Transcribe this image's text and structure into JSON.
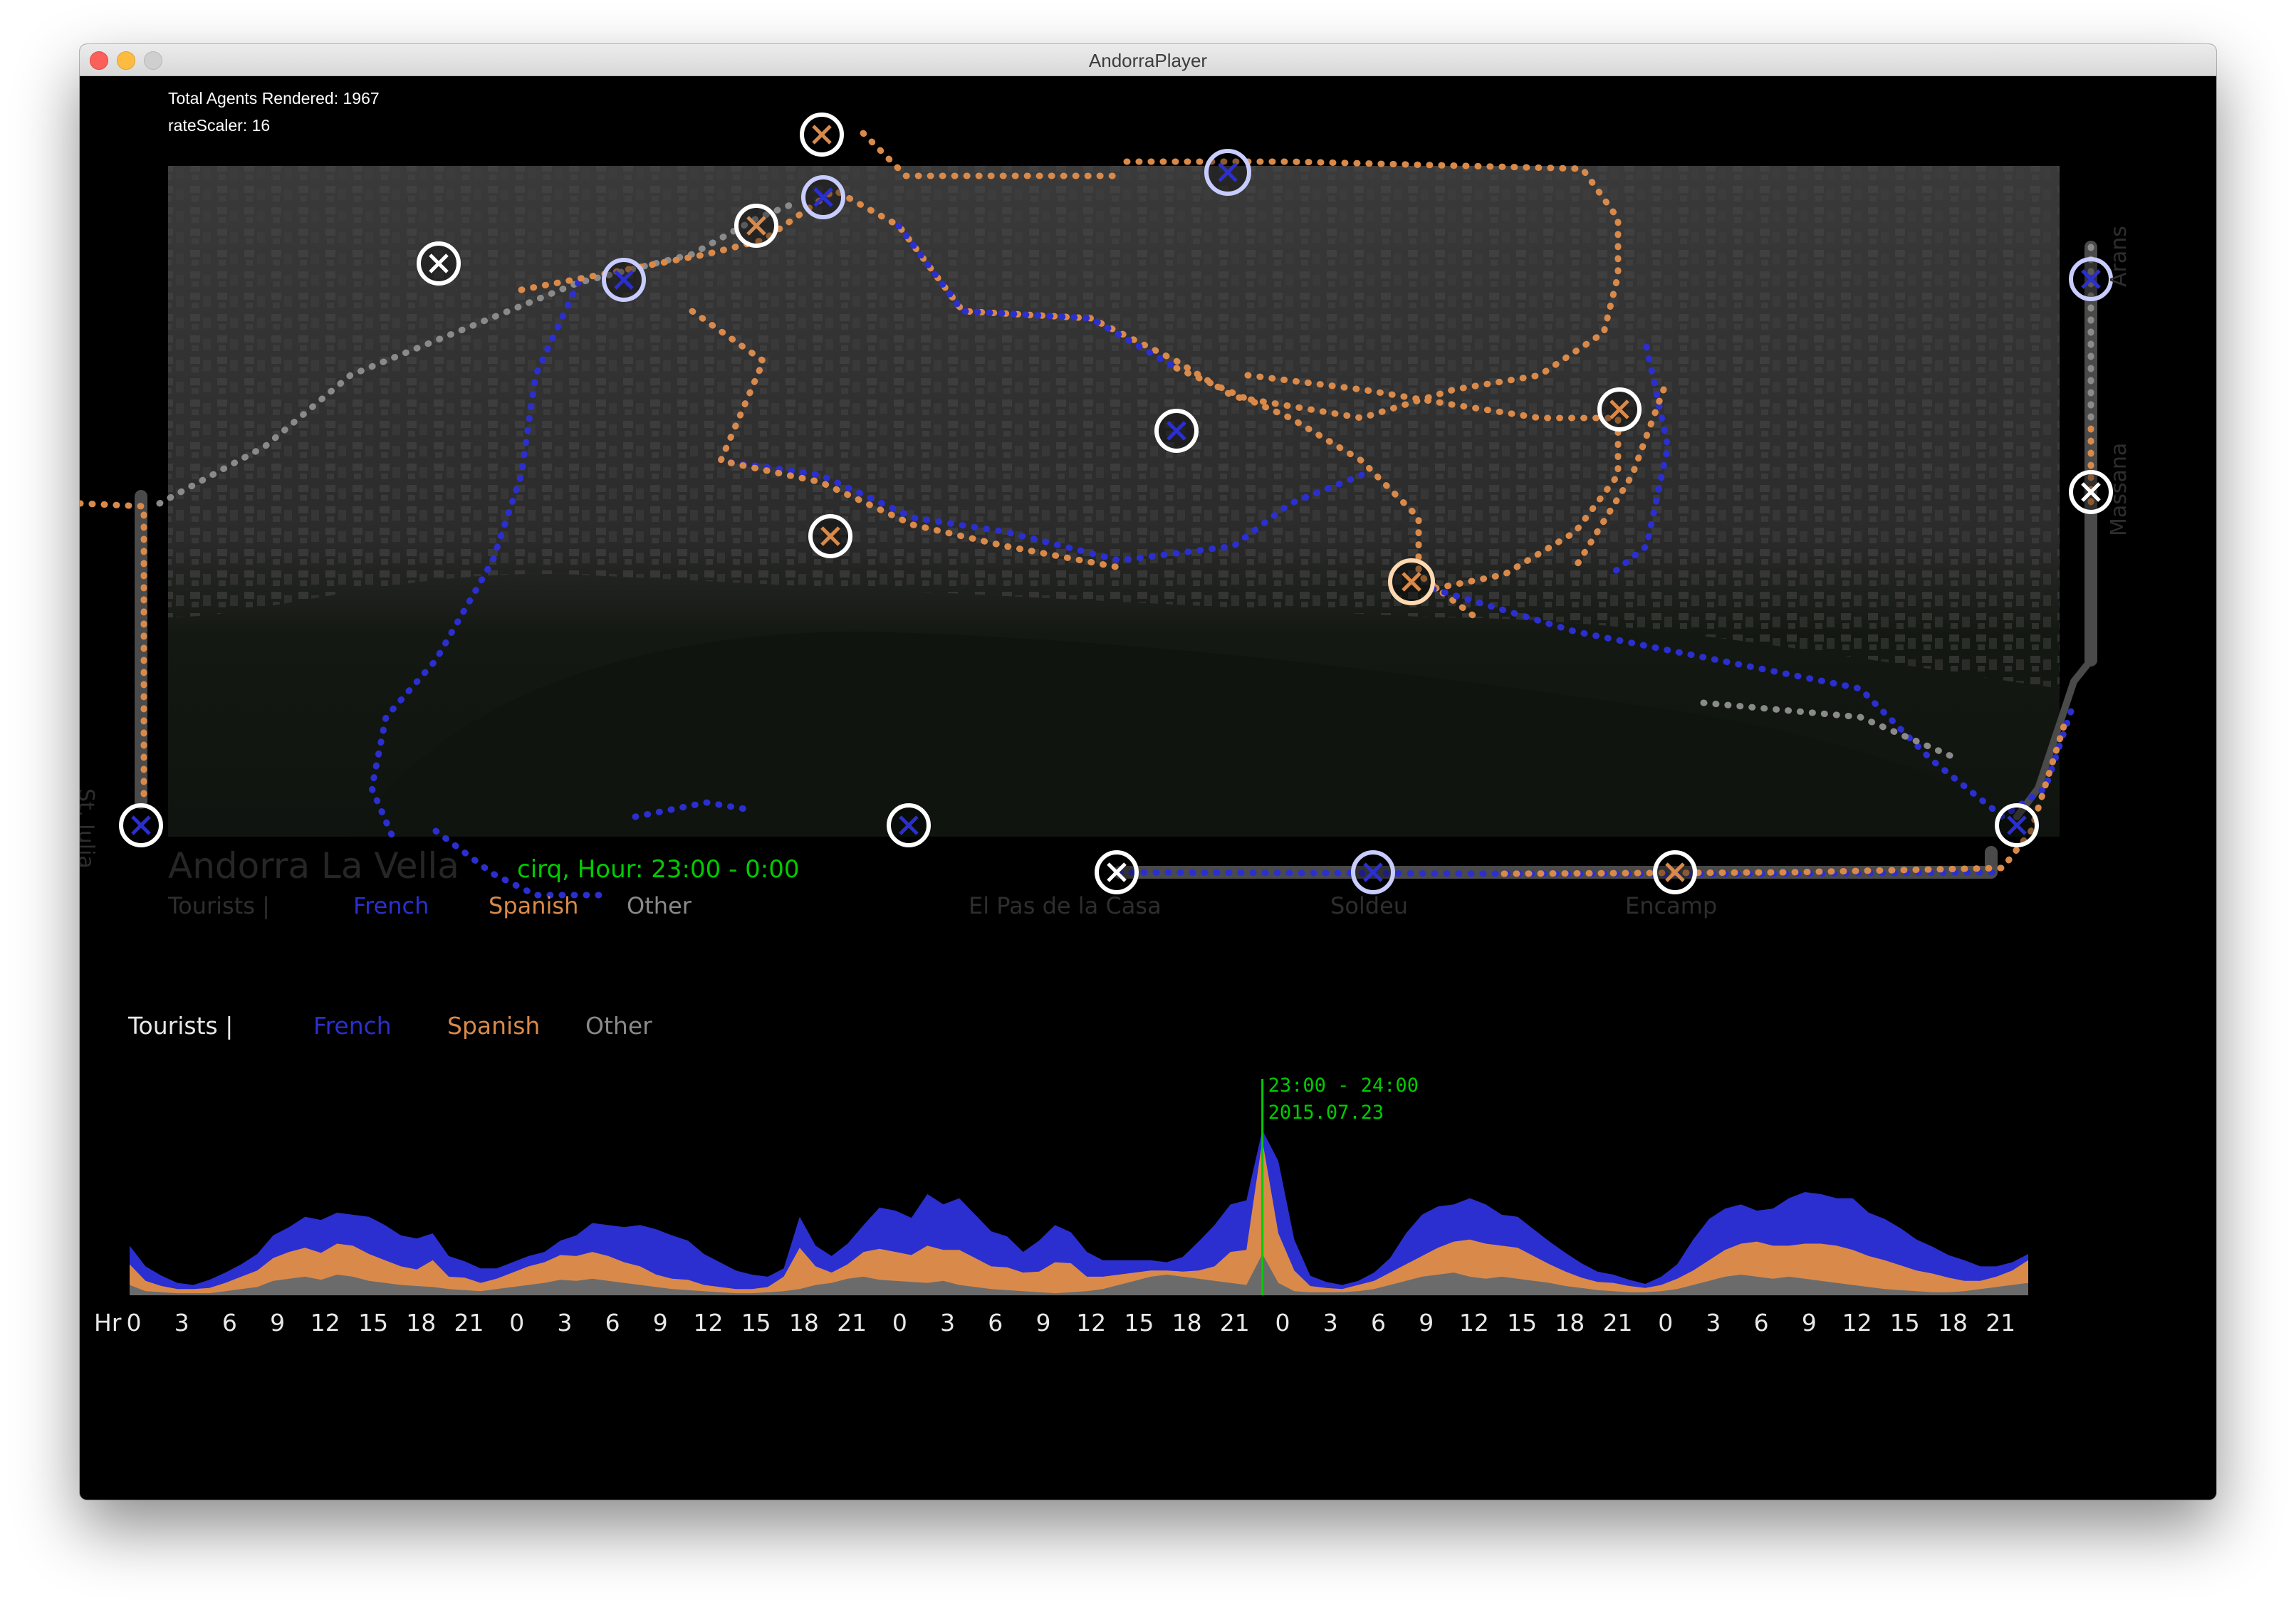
{
  "window": {
    "title": "AndorraPlayer"
  },
  "hud": {
    "agents_text": "Total Agents Rendered: 1967",
    "scaler_text": "rateScaler: 16"
  },
  "map": {
    "city_name": "Andorra La Vella",
    "status_text": "cirq, Hour: 23:00 - 0:00",
    "legend": {
      "prefix": "Tourists |",
      "french": "French",
      "spanish": "Spanish",
      "other": "Other"
    },
    "towns": {
      "st_julia": "St. Julia",
      "arans": "Arans",
      "massana": "Massana",
      "el_pas": "El Pas de la Casa",
      "soldeu": "Soldeu",
      "encamp": "Encamp"
    }
  },
  "chart_legend": {
    "prefix": "Tourists |",
    "french": "French",
    "spanish": "Spanish",
    "other": "Other"
  },
  "colors": {
    "french": "#2b2fcf",
    "spanish": "#d98a4a",
    "other": "#6b6b6b",
    "highlight": "#00cc00"
  },
  "chart_data": {
    "type": "area",
    "stacked": true,
    "x_label": "Hr",
    "x_tick_labels": [
      "0",
      "3",
      "6",
      "9",
      "12",
      "15",
      "18",
      "21",
      "0",
      "3",
      "6",
      "9",
      "12",
      "15",
      "18",
      "21",
      "0",
      "3",
      "6",
      "9",
      "12",
      "15",
      "18",
      "21",
      "0",
      "3",
      "6",
      "9",
      "12",
      "15",
      "18",
      "21",
      "0",
      "3",
      "6",
      "9",
      "12",
      "15",
      "18",
      "21"
    ],
    "hours_per_step": 1,
    "total_hours": 120,
    "highlight": {
      "hour_index": 71,
      "label": "23:00 - 24:00",
      "date": "2015.07.23"
    },
    "series": [
      {
        "name": "Other",
        "values": [
          10,
          4,
          3,
          2,
          2,
          2,
          4,
          6,
          8,
          14,
          16,
          18,
          15,
          20,
          18,
          14,
          12,
          10,
          9,
          8,
          6,
          5,
          4,
          6,
          8,
          10,
          12,
          15,
          14,
          16,
          14,
          12,
          10,
          8,
          6,
          5,
          4,
          3,
          2,
          2,
          3,
          4,
          6,
          10,
          12,
          16,
          18,
          15,
          14,
          13,
          12,
          14,
          10,
          8,
          6,
          5,
          4,
          3,
          2,
          3,
          4,
          6,
          10,
          14,
          18,
          20,
          18,
          16,
          14,
          12,
          10,
          40,
          12,
          4,
          3,
          3,
          3,
          4,
          6,
          10,
          14,
          18,
          20,
          22,
          18,
          16,
          18,
          16,
          14,
          12,
          9,
          7,
          5,
          4,
          3,
          3,
          4,
          6,
          10,
          14,
          18,
          20,
          18,
          16,
          18,
          16,
          14,
          12,
          10,
          8,
          6,
          5,
          4,
          3,
          3,
          4,
          6,
          8,
          10,
          12
        ]
      },
      {
        "name": "Spanish",
        "values": [
          20,
          10,
          6,
          4,
          4,
          5,
          8,
          12,
          16,
          22,
          26,
          28,
          26,
          30,
          30,
          26,
          22,
          18,
          16,
          26,
          12,
          12,
          8,
          10,
          14,
          18,
          20,
          24,
          24,
          26,
          24,
          20,
          18,
          12,
          10,
          10,
          6,
          5,
          4,
          4,
          5,
          14,
          40,
          18,
          10,
          14,
          24,
          30,
          28,
          26,
          36,
          30,
          34,
          28,
          22,
          22,
          18,
          20,
          30,
          28,
          14,
          12,
          10,
          8,
          6,
          4,
          5,
          8,
          14,
          30,
          34,
          110,
          48,
          20,
          6,
          4,
          3,
          6,
          8,
          12,
          16,
          20,
          26,
          30,
          36,
          34,
          30,
          30,
          24,
          18,
          14,
          10,
          8,
          8,
          6,
          4,
          6,
          10,
          14,
          20,
          26,
          30,
          34,
          32,
          30,
          34,
          36,
          36,
          34,
          30,
          28,
          24,
          20,
          18,
          14,
          10,
          8,
          10,
          14,
          22
        ]
      },
      {
        "name": "French",
        "values": [
          18,
          14,
          10,
          6,
          4,
          8,
          10,
          12,
          16,
          22,
          24,
          30,
          32,
          30,
          30,
          36,
          34,
          30,
          30,
          26,
          20,
          16,
          14,
          10,
          10,
          10,
          10,
          14,
          20,
          28,
          30,
          34,
          40,
          44,
          42,
          38,
          30,
          24,
          18,
          14,
          10,
          8,
          30,
          20,
          16,
          20,
          26,
          40,
          40,
          36,
          50,
          44,
          50,
          42,
          34,
          30,
          20,
          30,
          36,
          30,
          24,
          16,
          14,
          12,
          10,
          8,
          14,
          28,
          40,
          46,
          48,
          10,
          70,
          30,
          10,
          6,
          4,
          4,
          8,
          14,
          30,
          40,
          40,
          36,
          40,
          38,
          30,
          30,
          26,
          22,
          18,
          14,
          10,
          8,
          6,
          4,
          8,
          14,
          30,
          40,
          40,
          38,
          30,
          36,
          46,
          50,
          48,
          46,
          50,
          42,
          40,
          36,
          30,
          26,
          22,
          20,
          14,
          10,
          8,
          6
        ]
      }
    ],
    "grid": false
  }
}
